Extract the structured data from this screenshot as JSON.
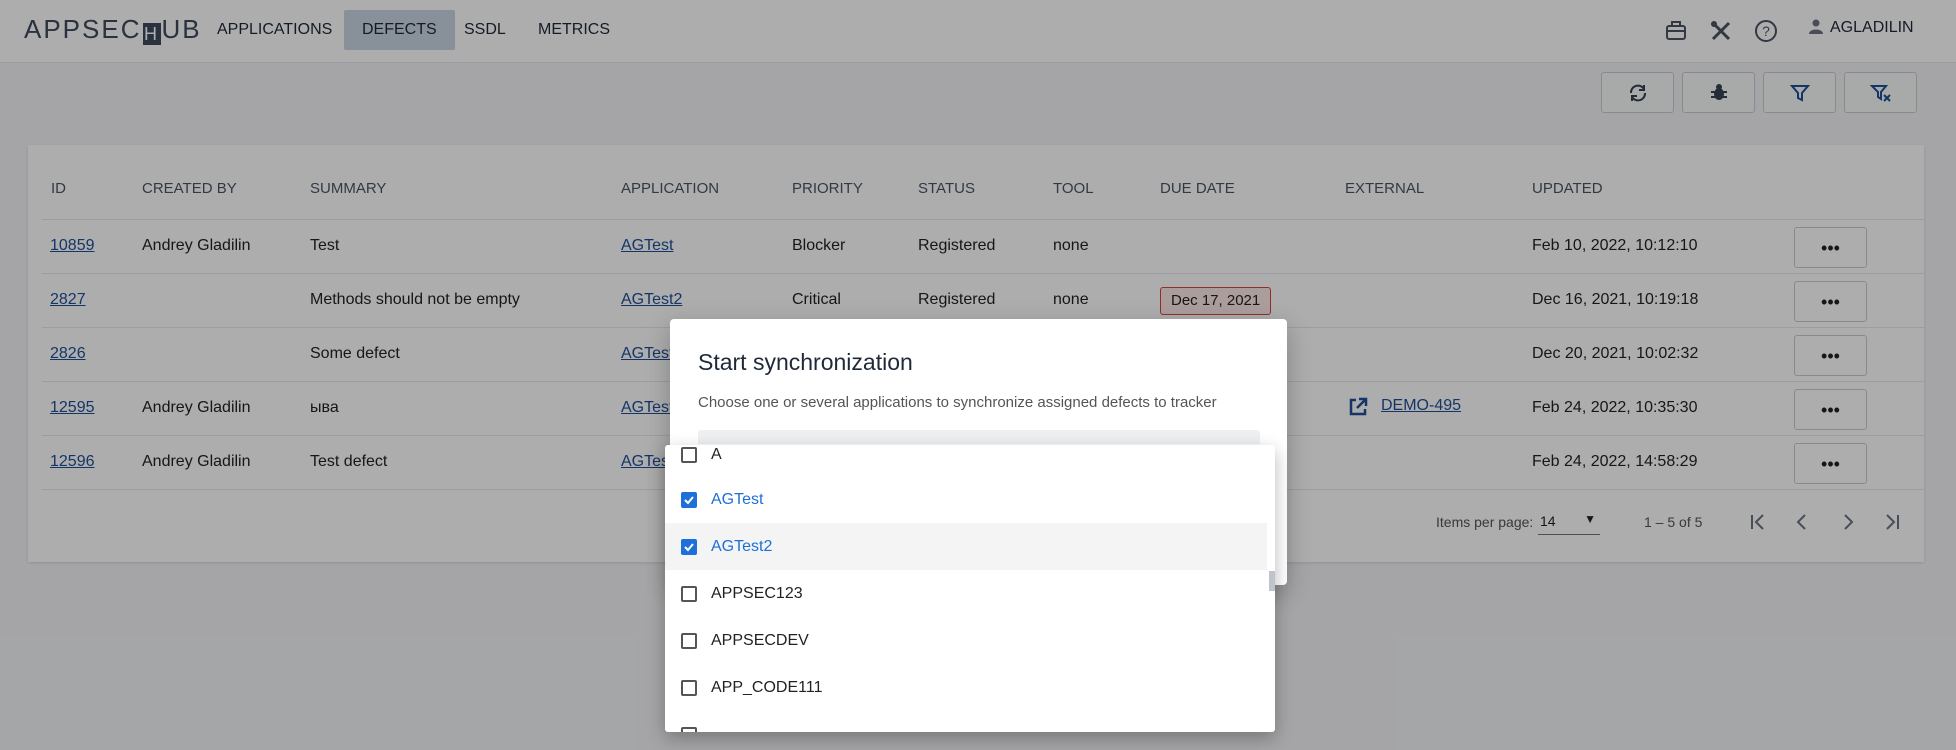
{
  "header": {
    "logo_text": "APPSEC",
    "logo_h": "H",
    "logo_tail": "UB",
    "nav": [
      {
        "label": "APPLICATIONS",
        "active": false
      },
      {
        "label": "DEFECTS",
        "active": true
      },
      {
        "label": "SSDL",
        "active": false
      },
      {
        "label": "METRICS",
        "active": false
      }
    ],
    "icons": [
      "briefcase-icon",
      "tools-icon",
      "help-icon"
    ],
    "user": "AGLADILIN"
  },
  "toolbar": {
    "buttons": [
      "sync-icon",
      "bug-icon",
      "filter-icon",
      "clear-filter-icon"
    ]
  },
  "table": {
    "columns": [
      "ID",
      "CREATED BY",
      "SUMMARY",
      "APPLICATION",
      "PRIORITY",
      "STATUS",
      "TOOL",
      "DUE DATE",
      "EXTERNAL",
      "UPDATED"
    ],
    "rows": [
      {
        "id": "10859",
        "created_by": "Andrey Gladilin",
        "summary": "Test",
        "application": "AGTest",
        "priority": "Blocker",
        "status": "Registered",
        "tool": "none",
        "due": "",
        "external": "",
        "updated": "Feb 10, 2022, 10:12:10"
      },
      {
        "id": "2827",
        "created_by": "",
        "summary": "Methods should not be empty",
        "application": "AGTest2",
        "priority": "Critical",
        "status": "Registered",
        "tool": "none",
        "due": "Dec 17, 2021",
        "external": "",
        "updated": "Dec 16, 2021, 10:19:18"
      },
      {
        "id": "2826",
        "created_by": "",
        "summary": "Some defect",
        "application": "AGTest",
        "priority": "",
        "status": "",
        "tool": "",
        "due": "",
        "external": "",
        "updated": "Dec 20, 2021, 10:02:32"
      },
      {
        "id": "12595",
        "created_by": "Andrey Gladilin",
        "summary": "ыва",
        "application": "AGTest",
        "priority": "",
        "status": "",
        "tool": "",
        "due": "",
        "external": "DEMO-495",
        "updated": "Feb 24, 2022, 10:35:30"
      },
      {
        "id": "12596",
        "created_by": "Andrey Gladilin",
        "summary": "Test defect",
        "application": "AGTest",
        "priority": "",
        "status": "",
        "tool": "",
        "due": "",
        "external": "",
        "updated": "Feb 24, 2022, 14:58:29"
      }
    ]
  },
  "paginator": {
    "items_per_page_label": "Items per page:",
    "items_per_page": "14",
    "range": "1 – 5 of 5"
  },
  "dialog": {
    "title": "Start synchronization",
    "description": "Choose one or several applications to synchronize assigned defects to tracker"
  },
  "dropdown": {
    "options": [
      {
        "label": "A",
        "checked": false
      },
      {
        "label": "AGTest",
        "checked": true
      },
      {
        "label": "AGTest2",
        "checked": true
      },
      {
        "label": "APPSEC123",
        "checked": false
      },
      {
        "label": "APPSECDEV",
        "checked": false
      },
      {
        "label": "APP_CODE111",
        "checked": false
      }
    ]
  },
  "colors": {
    "accent": "#1e6fd9",
    "link": "#1e4f99",
    "due_border": "#d6453d"
  }
}
